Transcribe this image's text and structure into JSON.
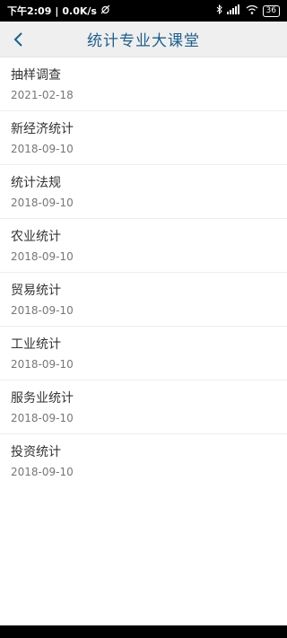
{
  "status_bar": {
    "time": "下午2:09",
    "separator": "|",
    "speed": "0.0K/s",
    "battery": "36"
  },
  "header": {
    "title": "统计专业大课堂",
    "back_icon": "chevron-left-icon"
  },
  "items": [
    {
      "title": "抽样调查",
      "date": "2021-02-18"
    },
    {
      "title": "新经济统计",
      "date": "2018-09-10"
    },
    {
      "title": "统计法规",
      "date": "2018-09-10"
    },
    {
      "title": "农业统计",
      "date": "2018-09-10"
    },
    {
      "title": "贸易统计",
      "date": "2018-09-10"
    },
    {
      "title": "工业统计",
      "date": "2018-09-10"
    },
    {
      "title": "服务业统计",
      "date": "2018-09-10"
    },
    {
      "title": "投资统计",
      "date": "2018-09-10"
    }
  ],
  "colors": {
    "accent": "#1f5f8b",
    "header_bg": "#efefef"
  }
}
